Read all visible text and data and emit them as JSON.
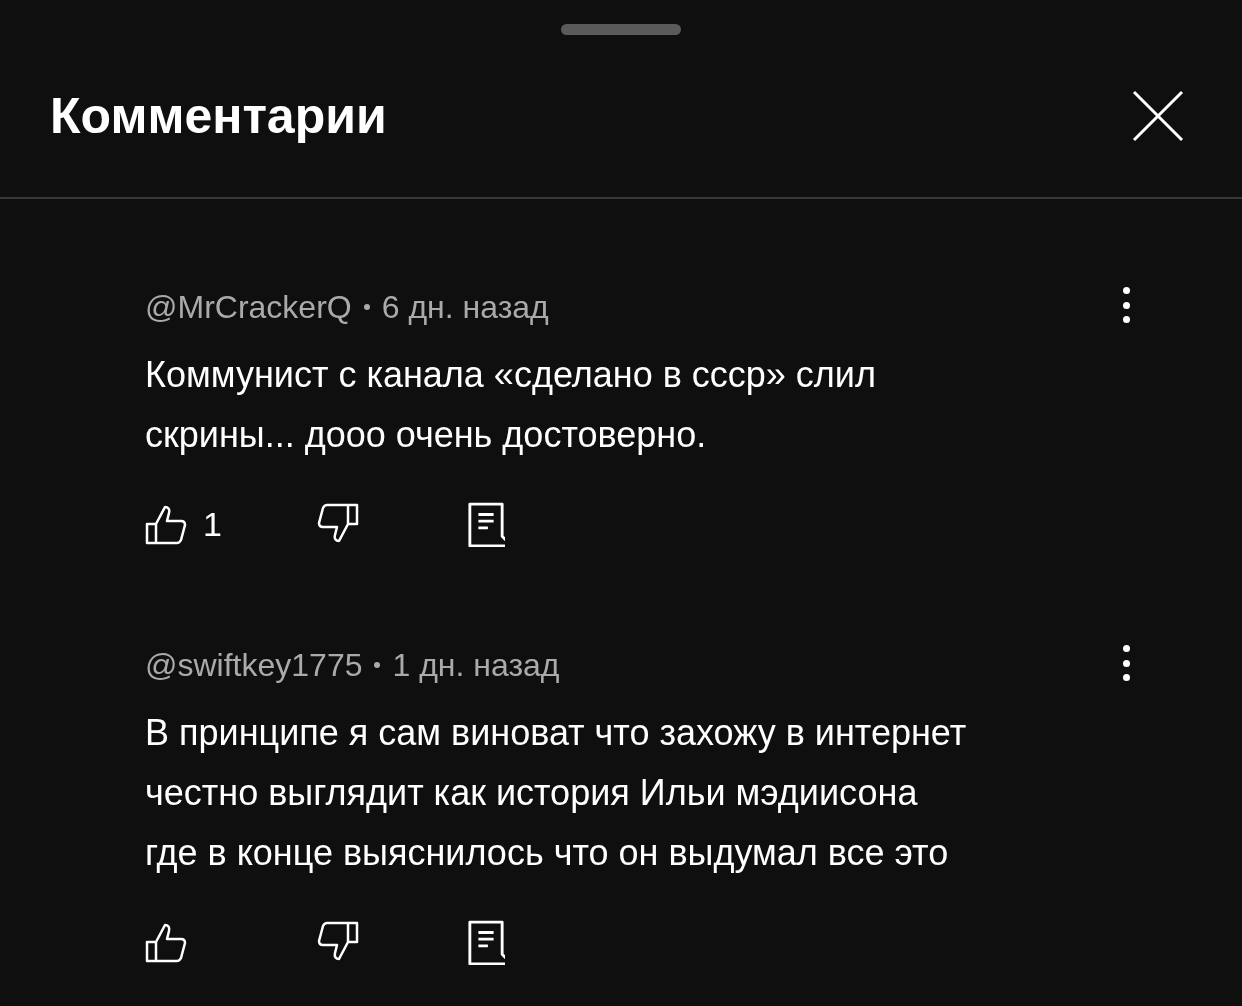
{
  "header": {
    "title": "Комментарии"
  },
  "comments": [
    {
      "author": "@MrCrackerQ",
      "time": "6 дн. назад",
      "lines": [
        "Коммунист с канала «сделано в ссср» слил",
        "скрины... дооо очень достоверно."
      ],
      "likes": "1"
    },
    {
      "author": "@swiftkey1775",
      "time": "1 дн. назад",
      "lines": [
        "В принципе я сам виноват что захожу в интернет",
        "честно выглядит как история Ильи мэдиисона",
        "где в конце выяснилось что он выдумал все это"
      ]
    }
  ]
}
